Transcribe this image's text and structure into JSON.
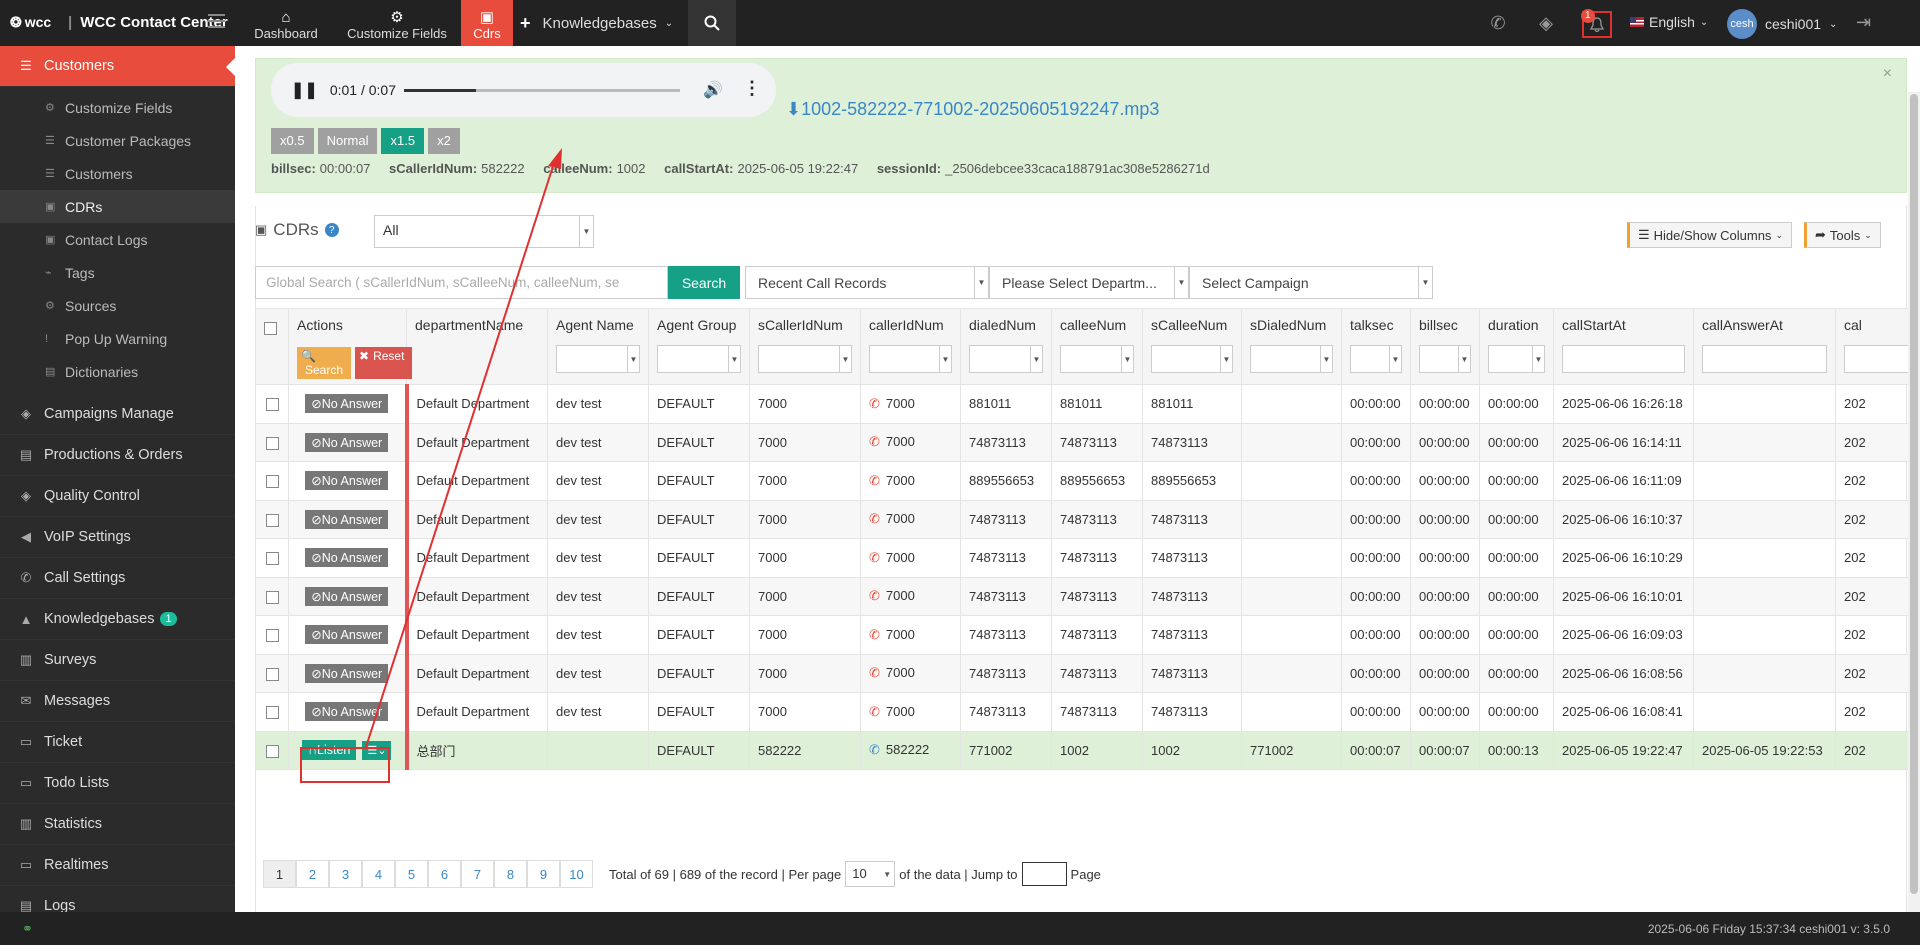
{
  "topbar": {
    "brand_logo": "wcc",
    "brand_title": "WCC Contact Center",
    "nav": [
      {
        "label": "Dashboard",
        "icon": "home-icon"
      },
      {
        "label": "Customize Fields",
        "icon": "gear-icon"
      },
      {
        "label": "Cdrs",
        "icon": "briefcase-icon"
      }
    ],
    "knowledgebases_label": "Knowledgebases",
    "notification_count": "1",
    "language": "English",
    "avatar_text": "cesh",
    "username": "ceshi001"
  },
  "sidebar": {
    "items": [
      {
        "label": "Customers",
        "icon": "database-icon",
        "active": true
      },
      {
        "label": "Campaigns Manage",
        "icon": "layers-icon"
      },
      {
        "label": "Productions & Orders",
        "icon": "document-icon"
      },
      {
        "label": "Quality Control",
        "icon": "layers-icon"
      },
      {
        "label": "VoIP Settings",
        "icon": "speaker-icon"
      },
      {
        "label": "Call Settings",
        "icon": "phone-icon"
      },
      {
        "label": "Knowledgebases",
        "icon": "graduation-icon",
        "badge": "1"
      },
      {
        "label": "Surveys",
        "icon": "survey-icon"
      },
      {
        "label": "Messages",
        "icon": "envelope-icon"
      },
      {
        "label": "Ticket",
        "icon": "folder-icon"
      },
      {
        "label": "Todo Lists",
        "icon": "folder-icon"
      },
      {
        "label": "Statistics",
        "icon": "bar-chart-icon"
      },
      {
        "label": "Realtimes",
        "icon": "monitor-icon"
      },
      {
        "label": "Logs",
        "icon": "log-icon"
      }
    ],
    "subitems": [
      {
        "label": "Customize Fields",
        "icon": "gear-icon"
      },
      {
        "label": "Customer Packages",
        "icon": "database-icon"
      },
      {
        "label": "Customers",
        "icon": "database-icon"
      },
      {
        "label": "CDRs",
        "icon": "briefcase-icon",
        "active": true
      },
      {
        "label": "Contact Logs",
        "icon": "briefcase-icon"
      },
      {
        "label": "Tags",
        "icon": "tag-icon"
      },
      {
        "label": "Sources",
        "icon": "gears-icon"
      },
      {
        "label": "Pop Up Warning",
        "icon": "exclamation-icon"
      },
      {
        "label": "Dictionaries",
        "icon": "book-icon"
      }
    ]
  },
  "player": {
    "time": "0:01 / 0:07",
    "progress": 0.26,
    "filename": "1002-582222-771002-20250605192247.mp3",
    "speeds": [
      "x0.5",
      "Normal",
      "x1.5",
      "x2"
    ],
    "active_speed": "x1.5",
    "info": [
      {
        "key": "billsec:",
        "value": "00:00:07"
      },
      {
        "key": "sCallerIdNum:",
        "value": "582222"
      },
      {
        "key": "calleeNum:",
        "value": "1002"
      },
      {
        "key": "callStartAt:",
        "value": "2025-06-05 19:22:47"
      },
      {
        "key": "sessionId:",
        "value": "_2506debcee33caca188791ac308e5286271d"
      }
    ]
  },
  "cdr": {
    "title": "CDRs",
    "filter_all": "All",
    "hide_show": "Hide/Show Columns",
    "tools": "Tools",
    "global_search_placeholder": "Global Search ( sCallerIdNum,  sCalleeNum,  calleeNum,  se",
    "search_button": "Search",
    "recent": "Recent Call Records",
    "department": "Please Select Departm...",
    "campaign": "Select Campaign",
    "col_search": "Search",
    "col_reset": "Reset"
  },
  "table": {
    "headers": [
      "Actions",
      "departmentName",
      "Agent Name",
      "Agent Group",
      "sCallerIdNum",
      "callerIdNum",
      "dialedNum",
      "calleeNum",
      "sCalleeNum",
      "sDialedNum",
      "talksec",
      "billsec",
      "duration",
      "callStartAt",
      "callAnswerAt",
      "cal"
    ],
    "no_answer": "No Answer",
    "listen": "Listen",
    "rows": [
      {
        "dept": "Default Department",
        "agent": "dev test",
        "group": "DEFAULT",
        "scaller": "7000",
        "caller": "7000",
        "dialed": "881011",
        "callee": "881011",
        "scallee": "881011",
        "sdialed": "",
        "talk": "00:00:00",
        "bill": "00:00:00",
        "dur": "00:00:00",
        "start": "2025-06-06 16:26:18",
        "answer": "",
        "cal": "202"
      },
      {
        "dept": "Default Department",
        "agent": "dev test",
        "group": "DEFAULT",
        "scaller": "7000",
        "caller": "7000",
        "dialed": "74873113",
        "callee": "74873113",
        "scallee": "74873113",
        "sdialed": "",
        "talk": "00:00:00",
        "bill": "00:00:00",
        "dur": "00:00:00",
        "start": "2025-06-06 16:14:11",
        "answer": "",
        "cal": "202"
      },
      {
        "dept": "Default Department",
        "agent": "dev test",
        "group": "DEFAULT",
        "scaller": "7000",
        "caller": "7000",
        "dialed": "889556653",
        "callee": "889556653",
        "scallee": "889556653",
        "sdialed": "",
        "talk": "00:00:00",
        "bill": "00:00:00",
        "dur": "00:00:00",
        "start": "2025-06-06 16:11:09",
        "answer": "",
        "cal": "202"
      },
      {
        "dept": "Default Department",
        "agent": "dev test",
        "group": "DEFAULT",
        "scaller": "7000",
        "caller": "7000",
        "dialed": "74873113",
        "callee": "74873113",
        "scallee": "74873113",
        "sdialed": "",
        "talk": "00:00:00",
        "bill": "00:00:00",
        "dur": "00:00:00",
        "start": "2025-06-06 16:10:37",
        "answer": "",
        "cal": "202"
      },
      {
        "dept": "Default Department",
        "agent": "dev test",
        "group": "DEFAULT",
        "scaller": "7000",
        "caller": "7000",
        "dialed": "74873113",
        "callee": "74873113",
        "scallee": "74873113",
        "sdialed": "",
        "talk": "00:00:00",
        "bill": "00:00:00",
        "dur": "00:00:00",
        "start": "2025-06-06 16:10:29",
        "answer": "",
        "cal": "202"
      },
      {
        "dept": "Default Department",
        "agent": "dev test",
        "group": "DEFAULT",
        "scaller": "7000",
        "caller": "7000",
        "dialed": "74873113",
        "callee": "74873113",
        "scallee": "74873113",
        "sdialed": "",
        "talk": "00:00:00",
        "bill": "00:00:00",
        "dur": "00:00:00",
        "start": "2025-06-06 16:10:01",
        "answer": "",
        "cal": "202"
      },
      {
        "dept": "Default Department",
        "agent": "dev test",
        "group": "DEFAULT",
        "scaller": "7000",
        "caller": "7000",
        "dialed": "74873113",
        "callee": "74873113",
        "scallee": "74873113",
        "sdialed": "",
        "talk": "00:00:00",
        "bill": "00:00:00",
        "dur": "00:00:00",
        "start": "2025-06-06 16:09:03",
        "answer": "",
        "cal": "202"
      },
      {
        "dept": "Default Department",
        "agent": "dev test",
        "group": "DEFAULT",
        "scaller": "7000",
        "caller": "7000",
        "dialed": "74873113",
        "callee": "74873113",
        "scallee": "74873113",
        "sdialed": "",
        "talk": "00:00:00",
        "bill": "00:00:00",
        "dur": "00:00:00",
        "start": "2025-06-06 16:08:56",
        "answer": "",
        "cal": "202"
      },
      {
        "dept": "Default Department",
        "agent": "dev test",
        "group": "DEFAULT",
        "scaller": "7000",
        "caller": "7000",
        "dialed": "74873113",
        "callee": "74873113",
        "scallee": "74873113",
        "sdialed": "",
        "talk": "00:00:00",
        "bill": "00:00:00",
        "dur": "00:00:00",
        "start": "2025-06-06 16:08:41",
        "answer": "",
        "cal": "202"
      },
      {
        "dept": "总部门",
        "agent": "",
        "group": "DEFAULT",
        "scaller": "582222",
        "caller": "582222",
        "dialed": "771002",
        "callee": "1002",
        "scallee": "1002",
        "sdialed": "771002",
        "talk": "00:00:07",
        "bill": "00:00:07",
        "dur": "00:00:13",
        "start": "2025-06-05 19:22:47",
        "answer": "2025-06-05 19:22:53",
        "cal": "202",
        "listen": true
      }
    ]
  },
  "pager": {
    "pages": [
      "1",
      "2",
      "3",
      "4",
      "5",
      "6",
      "7",
      "8",
      "9",
      "10"
    ],
    "current": "1",
    "total_text": "Total of 69 | 689 of the record | Per page",
    "per_page": "10",
    "of_data": "of the data | Jump to",
    "page_word": "Page"
  },
  "footer": {
    "status": "2025-06-06 Friday 15:37:34  ceshi001   v: 3.5.0"
  }
}
